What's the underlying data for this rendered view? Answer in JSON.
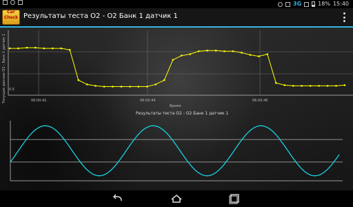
{
  "status_bar": {
    "signal_label": "3G",
    "battery_percent": "18%",
    "time": "15:40"
  },
  "action_bar": {
    "logo_text": "Car Check",
    "title": "Результаты теста O2 - O2 Банк 1 датчик 1"
  },
  "colors": {
    "accent": "#33b5e5",
    "series_top": "#ffff00",
    "series_bottom": "#19d3e3",
    "grid": "#a0a0a0"
  },
  "navigation": {
    "back_icon": "back-icon",
    "home_icon": "home-icon",
    "recents_icon": "recents-icon"
  },
  "chart_data": [
    {
      "type": "line",
      "ylabel": "Текущие данные O2 - Банк 1 датчик 1",
      "xlabel": "Время",
      "xtick_labels": [
        "06:00:42",
        "06:00:44",
        "06:00:46"
      ],
      "ytick_labels": [
        "0.5"
      ],
      "grid": true,
      "series": [
        {
          "values": [
            0.7,
            0.7,
            0.71,
            0.71,
            0.7,
            0.7,
            0.7,
            0.68,
            0.26,
            0.2,
            0.18,
            0.17,
            0.17,
            0.17,
            0.17,
            0.17,
            0.17,
            0.2,
            0.26,
            0.54,
            0.6,
            0.62,
            0.66,
            0.67,
            0.67,
            0.66,
            0.66,
            0.64,
            0.61,
            0.59,
            0.62,
            0.22,
            0.19,
            0.18,
            0.18,
            0.18,
            0.18,
            0.18,
            0.18,
            0.19
          ],
          "ylim": [
            0.05,
            0.95
          ]
        }
      ]
    },
    {
      "type": "line",
      "title": "Результаты теста O2 - O2 Банк 1 датчик 1",
      "grid": true,
      "series": [
        {
          "x_start": 0,
          "x_end": 3.05,
          "ylim": [
            -1.2,
            1.2
          ],
          "amplitude": 1.0,
          "cycles": 3,
          "phase": "sine",
          "y_at_x0": -0.45
        }
      ],
      "reference_lines": [
        0.45,
        -0.45
      ]
    }
  ]
}
